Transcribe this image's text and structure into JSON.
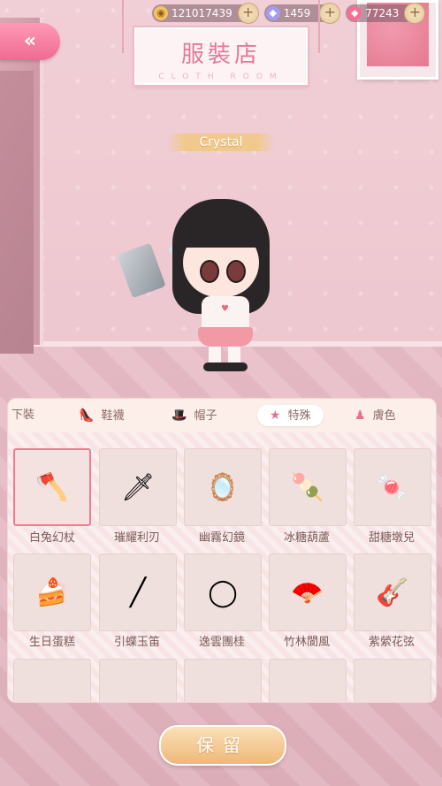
{
  "currency": {
    "coins": "121017439",
    "gems": "1459",
    "diamonds": "77243"
  },
  "shop": {
    "title": "服裝店",
    "subtitle": "CLOTH ROOM"
  },
  "character": {
    "name": "Crystal"
  },
  "tabs": [
    {
      "label": "下裝",
      "active": false
    },
    {
      "label": "鞋襪",
      "active": false
    },
    {
      "label": "帽子",
      "active": false
    },
    {
      "label": "特殊",
      "active": true
    },
    {
      "label": "膚色",
      "active": false
    }
  ],
  "items": [
    {
      "label": "白兔幻杖",
      "icon": "axe-icon",
      "selected": true
    },
    {
      "label": "璀耀利刃",
      "icon": "sword-icon",
      "selected": false
    },
    {
      "label": "幽霧幻鏡",
      "icon": "mirror-icon",
      "selected": false
    },
    {
      "label": "冰糖葫蘆",
      "icon": "candied-haws-icon",
      "selected": false
    },
    {
      "label": "甜糖墩兒",
      "icon": "candy-stick-icon",
      "selected": false
    },
    {
      "label": "生日蛋糕",
      "icon": "cake-icon",
      "selected": false
    },
    {
      "label": "引蝶玉笛",
      "icon": "flute-icon",
      "selected": false
    },
    {
      "label": "逸雲團桂",
      "icon": "round-fan-icon",
      "selected": false
    },
    {
      "label": "竹林閬風",
      "icon": "folding-fan-icon",
      "selected": false
    },
    {
      "label": "紫縈花弦",
      "icon": "guitar-icon",
      "selected": false
    }
  ],
  "buttons": {
    "keep": "保留"
  }
}
